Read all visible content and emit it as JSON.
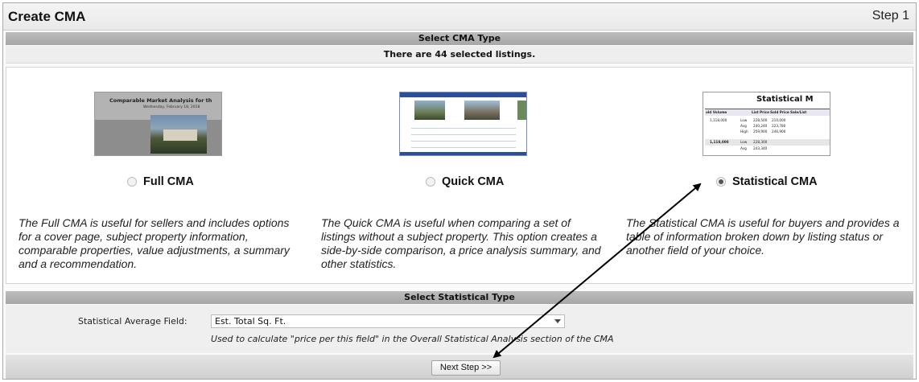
{
  "header": {
    "title": "Create CMA",
    "step": "Step 1"
  },
  "sections": {
    "cma_type": "Select CMA Type",
    "listing_count": "There are 44 selected listings.",
    "stat_type": "Select Statistical Type"
  },
  "cma_options": [
    {
      "label": "Full CMA",
      "selected": false,
      "description": "The Full CMA is useful for sellers and includes options for a cover page, subject property information, comparable properties, value adjustments, a summary and a recommendation.",
      "thumb": {
        "title": "Comparable Market Analysis for th",
        "subtitle": "Wednesday, February 18, 2018"
      }
    },
    {
      "label": "Quick CMA",
      "selected": false,
      "description": "The Quick CMA is useful when comparing a set of listings without a subject property. This option creates a side-by-side comparison, a price analysis summary, and other statistics."
    },
    {
      "label": "Statistical CMA",
      "selected": true,
      "description": "The Statistical CMA is useful for buyers and provides a table of information broken down by listing status or another field of your choice.",
      "thumb": {
        "title": "Statistical M",
        "headers": [
          "old Volume",
          "List Price",
          "Sold Price",
          "Sale/List"
        ],
        "rows": [
          [
            "1,118,000",
            "Low",
            "228,500",
            "210,000"
          ],
          [
            "",
            "Avg",
            "240,240",
            "223,780"
          ],
          [
            "",
            "High",
            "259,900",
            "246,900"
          ],
          [
            "1,118,000",
            "Low",
            "228,300",
            ""
          ],
          [
            "",
            "Avg",
            "243,340",
            ""
          ]
        ]
      }
    }
  ],
  "statistical": {
    "field_label": "Statistical Average Field:",
    "selected_value": "Est. Total Sq. Ft.",
    "hint": "Used to calculate \"price per this field\" in the Overall Statistical Analysis section of the CMA"
  },
  "footer": {
    "next_label": "Next Step >>"
  },
  "colors": {
    "arrow": "#000000",
    "section_bar": "#b0b0b0"
  }
}
